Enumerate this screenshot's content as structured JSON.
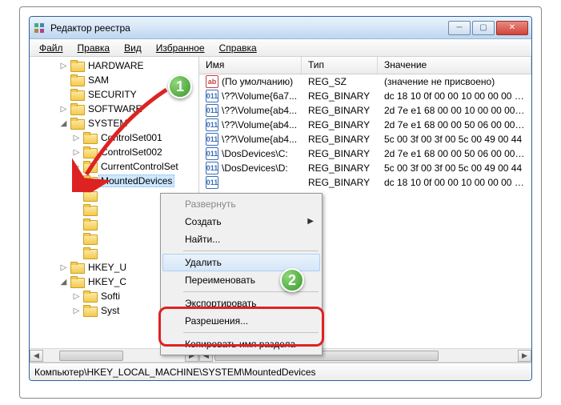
{
  "window": {
    "title": "Редактор реестра"
  },
  "menu": {
    "file": "Файл",
    "edit": "Правка",
    "view": "Вид",
    "favorites": "Избранное",
    "help": "Справка"
  },
  "columns": {
    "name": "Имя",
    "type": "Тип",
    "value": "Значение"
  },
  "tree": [
    {
      "level": 2,
      "exp": "▷",
      "label": "HARDWARE"
    },
    {
      "level": 2,
      "exp": "",
      "label": "SAM"
    },
    {
      "level": 2,
      "exp": "",
      "label": "SECURITY"
    },
    {
      "level": 2,
      "exp": "▷",
      "label": "SOFTWARE"
    },
    {
      "level": 2,
      "exp": "◢",
      "label": "SYSTEM"
    },
    {
      "level": 3,
      "exp": "▷",
      "label": "ControlSet001"
    },
    {
      "level": 3,
      "exp": "▷",
      "label": "ControlSet002"
    },
    {
      "level": 3,
      "exp": "▷",
      "label": "CurrentControlSet"
    },
    {
      "level": 3,
      "exp": "",
      "label": "MountedDevices",
      "sel": true
    },
    {
      "level": 3,
      "exp": "",
      "label": ""
    },
    {
      "level": 3,
      "exp": "",
      "label": ""
    },
    {
      "level": 3,
      "exp": "",
      "label": ""
    },
    {
      "level": 3,
      "exp": "",
      "label": ""
    },
    {
      "level": 3,
      "exp": "",
      "label": ""
    },
    {
      "level": 2,
      "exp": "▷",
      "label": "HKEY_U"
    },
    {
      "level": 2,
      "exp": "◢",
      "label": "HKEY_C"
    },
    {
      "level": 3,
      "exp": "▷",
      "label": "Softi"
    },
    {
      "level": 3,
      "exp": "▷",
      "label": "Syst"
    }
  ],
  "values": [
    {
      "icon": "sz",
      "name": "(По умолчанию)",
      "type": "REG_SZ",
      "value": "(значение не присвоено)"
    },
    {
      "icon": "bin",
      "name": "\\??\\Volume{6a7...",
      "type": "REG_BINARY",
      "value": "dc 18 10 0f 00 00 10 00 00 00 00 0"
    },
    {
      "icon": "bin",
      "name": "\\??\\Volume{ab4...",
      "type": "REG_BINARY",
      "value": "2d 7e e1 68 00 00 10 00 00 00 00 0"
    },
    {
      "icon": "bin",
      "name": "\\??\\Volume{ab4...",
      "type": "REG_BINARY",
      "value": "2d 7e e1 68 00 00 50 06 00 00 00"
    },
    {
      "icon": "bin",
      "name": "\\??\\Volume{ab4...",
      "type": "REG_BINARY",
      "value": "5c 00 3f 00 3f 00 5c 00 49 00 44"
    },
    {
      "icon": "bin",
      "name": "\\DosDevices\\C:",
      "type": "REG_BINARY",
      "value": "2d 7e e1 68 00 00 50 06 00 00 00"
    },
    {
      "icon": "bin",
      "name": "\\DosDevices\\D:",
      "type": "REG_BINARY",
      "value": "5c 00 3f 00 3f 00 5c 00 49 00 44"
    },
    {
      "icon": "bin",
      "name": "",
      "type": "REG_BINARY",
      "value": "dc 18 10 0f 00 00 10 00 00 00 00 0"
    }
  ],
  "context": {
    "expand": "Развернуть",
    "new": "Создать",
    "find": "Найти...",
    "delete": "Удалить",
    "rename": "Переименовать",
    "export": "Экспортировать",
    "permissions": "Разрешения...",
    "copyname": "Копировать имя раздела"
  },
  "statusbar": "Компьютер\\HKEY_LOCAL_MACHINE\\SYSTEM\\MountedDevices",
  "callouts": {
    "one": "1",
    "two": "2"
  }
}
